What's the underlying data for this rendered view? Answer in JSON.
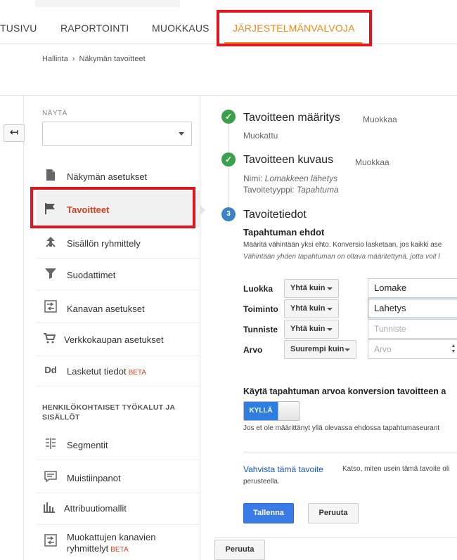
{
  "nav": {
    "tabs": [
      {
        "label": "TUSIVU"
      },
      {
        "label": "RAPORTOINTI"
      },
      {
        "label": "MUOKKAUS"
      },
      {
        "label": "JÄRJESTELMÄNVALVOJA"
      }
    ],
    "active_tab_index": 3,
    "accent_color": "#f08b1d"
  },
  "breadcrumb": {
    "root": "Hallinta",
    "separator": "›",
    "current": "Näkymän tavoitteet"
  },
  "sidebar": {
    "view_label": "NÄYTÄ",
    "view_value": "",
    "items": [
      {
        "label": "Näkymän asetukset",
        "icon": "document-icon"
      },
      {
        "label": "Tavoitteet",
        "icon": "flag-icon",
        "active": true
      },
      {
        "label": "Sisällön ryhmittely",
        "icon": "grouping-icon"
      },
      {
        "label": "Suodattimet",
        "icon": "filter-icon"
      },
      {
        "label": "Kanavan asetukset",
        "icon": "channel-icon"
      },
      {
        "label": "Verkkokaupan asetukset",
        "icon": "cart-icon"
      },
      {
        "label": "Lasketut tiedot",
        "icon": "dd-icon",
        "badge": "BETA"
      }
    ],
    "section_title": "HENKILÖKOHTAISET TYÖKALUT JA SISÄLLÖT",
    "personal_items": [
      {
        "label": "Segmentit",
        "icon": "segments-icon"
      },
      {
        "label": "Muistiinpanot",
        "icon": "annotations-icon"
      },
      {
        "label": "Attribuutiomallit",
        "icon": "attribution-icon"
      },
      {
        "label": "Muokattujen kanavien ryhmittelyt",
        "icon": "channel-icon",
        "badge": "BETA"
      }
    ]
  },
  "steps": {
    "step1": {
      "title": "Tavoitteen määritys",
      "edit": "Muokkaa",
      "summary": "Muokattu"
    },
    "step2": {
      "title": "Tavoitteen kuvaus",
      "edit": "Muokkaa",
      "name_label": "Nimi:",
      "name_value": "Lomakkeen lähetys",
      "type_label": "Tavoitetyyppi:",
      "type_value": "Tapahtuma"
    },
    "step3": {
      "number": "3",
      "title": "Tavoitetiedot"
    }
  },
  "event_conditions": {
    "heading": "Tapahtuman ehdot",
    "desc": "Määritä vähintään yksi ehto. Konversio lasketaan, jos kaikki ase",
    "note": "Vähintään yhden tapahtuman on oltava määritettynä, jotta voit l",
    "rows": [
      {
        "label": "Luokka",
        "operator": "Yhtä kuin",
        "value": "Lomake",
        "placeholder": ""
      },
      {
        "label": "Toiminto",
        "operator": "Yhtä kuin",
        "value": "Lahetys",
        "placeholder": ""
      },
      {
        "label": "Tunniste",
        "operator": "Yhtä kuin",
        "value": "",
        "placeholder": "Tunniste"
      },
      {
        "label": "Arvo",
        "operator": "Suurempi kuin",
        "value": "",
        "placeholder": "Arvo"
      }
    ]
  },
  "use_value": {
    "question": "Käytä tapahtuman arvoa konversion tavoitteen a",
    "toggle_label": "KYLLÄ",
    "toggle_on": true,
    "help": "Jos et ole määrittänyt yllä olevassa ehdossa tapahtumaseurant"
  },
  "verify": {
    "link": "Vahvista tämä tavoite",
    "text": "Katso, miten usein tämä tavoite oli",
    "text2": "perusteella."
  },
  "actions": {
    "save": "Tallenna",
    "cancel": "Peruuta",
    "cancel_bottom": "Peruuta"
  },
  "colors": {
    "annotation_red": "#e0161f",
    "active_red": "#d64122",
    "primary_blue": "#3b7be8",
    "done_green": "#3aa14a",
    "step_blue": "#3b83c5"
  }
}
